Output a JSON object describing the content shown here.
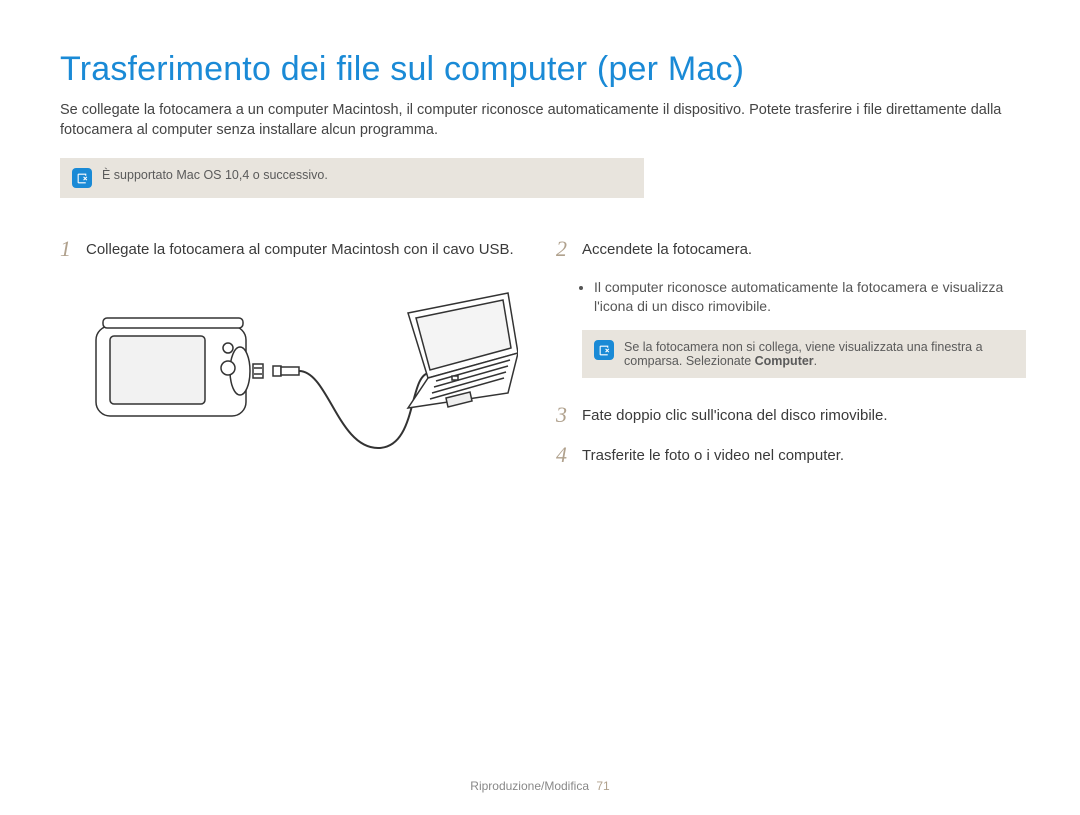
{
  "title": "Trasferimento dei file sul computer (per Mac)",
  "intro": "Se collegate la fotocamera a un computer Macintosh, il computer riconosce automaticamente il dispositivo. Potete trasferire i file direttamente dalla fotocamera al computer senza installare alcun programma.",
  "topNote": "È supportato Mac OS 10,4 o successivo.",
  "steps": {
    "s1": {
      "num": "1",
      "text": "Collegate la fotocamera al computer Macintosh con il cavo USB."
    },
    "s2": {
      "num": "2",
      "text": "Accendete la fotocamera."
    },
    "s3": {
      "num": "3",
      "text": "Fate doppio clic sull'icona del disco rimovibile."
    },
    "s4": {
      "num": "4",
      "text": "Trasferite le foto o i video nel computer."
    }
  },
  "step2Bullet": "Il computer riconosce automaticamente la fotocamera e visualizza l'icona di un disco rimovibile.",
  "rightNote_a": "Se la fotocamera non si collega, viene visualizzata una finestra a comparsa. Selezionate ",
  "rightNote_b": "Computer",
  "rightNote_c": ".",
  "footer": {
    "section": "Riproduzione/Modifica",
    "page": "71"
  }
}
